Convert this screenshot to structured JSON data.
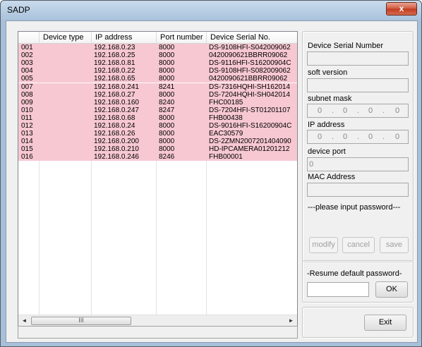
{
  "window": {
    "title": "SADP",
    "close_label": "x"
  },
  "device_list": {
    "columns": [
      "",
      "Device type",
      "IP address",
      "Port number",
      "Device Serial No."
    ],
    "rows": [
      {
        "id": "001",
        "type": "",
        "ip": "192.168.0.23",
        "port": "8000",
        "serial": "DS-9108HFI-S042009062"
      },
      {
        "id": "002",
        "type": "",
        "ip": "192.168.0.25",
        "port": "8000",
        "serial": "0420090621BBRR09062"
      },
      {
        "id": "003",
        "type": "",
        "ip": "192.168.0.81",
        "port": "8000",
        "serial": "DS-9116HFI-S16200904C"
      },
      {
        "id": "004",
        "type": "",
        "ip": "192.168.0.22",
        "port": "8000",
        "serial": "DS-9108HFI-S082009062"
      },
      {
        "id": "005",
        "type": "",
        "ip": "192.168.0.65",
        "port": "8000",
        "serial": "0420090621BBRR09062"
      },
      {
        "id": "007",
        "type": "",
        "ip": "192.168.0.241",
        "port": "8241",
        "serial": "DS-7316HQHI-SH162014"
      },
      {
        "id": "008",
        "type": "",
        "ip": "192.168.0.27",
        "port": "8000",
        "serial": "DS-7204HQHI-SH042014"
      },
      {
        "id": "009",
        "type": "",
        "ip": "192.168.0.160",
        "port": "8240",
        "serial": "FHC00185"
      },
      {
        "id": "010",
        "type": "",
        "ip": "192.168.0.247",
        "port": "8247",
        "serial": "DS-7204HFI-ST01201107"
      },
      {
        "id": "011",
        "type": "",
        "ip": "192.168.0.68",
        "port": "8000",
        "serial": "FHB00438"
      },
      {
        "id": "012",
        "type": "",
        "ip": "192.168.0.24",
        "port": "8000",
        "serial": "DS-9016HFI-S16200904C"
      },
      {
        "id": "013",
        "type": "",
        "ip": "192.168.0.26",
        "port": "8000",
        "serial": "EAC30579"
      },
      {
        "id": "014",
        "type": "",
        "ip": "192.168.0.200",
        "port": "8000",
        "serial": "DS-2ZMN2007201404090"
      },
      {
        "id": "015",
        "type": "",
        "ip": "192.168.0.210",
        "port": "8000",
        "serial": "HD-IPCAMERA01201212"
      },
      {
        "id": "016",
        "type": "",
        "ip": "192.168.0.246",
        "port": "8246",
        "serial": "FHB00001"
      }
    ],
    "row_color": "#f7c8d2",
    "scroll_thumb_label": "III",
    "scroll_left": "◄",
    "scroll_right": "►"
  },
  "details": {
    "serial_label": "Device Serial Number",
    "serial_value": "",
    "soft_version_label": "soft version",
    "soft_version_value": "",
    "subnet_label": "subnet mask",
    "subnet_octets": [
      "0",
      "0",
      "0",
      "0"
    ],
    "ip_label": "IP address",
    "ip_octets": [
      "0",
      "0",
      "0",
      "0"
    ],
    "port_label": "device port",
    "port_value": "0",
    "mac_label": "MAC Address",
    "mac_value": "",
    "password_prompt": "---please input password---",
    "modify_label": "modify",
    "cancel_label": "cancel",
    "save_label": "save"
  },
  "resume": {
    "title": "-Resume default password-",
    "input_value": "",
    "ok_label": "OK"
  },
  "exit_label": "Exit",
  "status_text": ""
}
